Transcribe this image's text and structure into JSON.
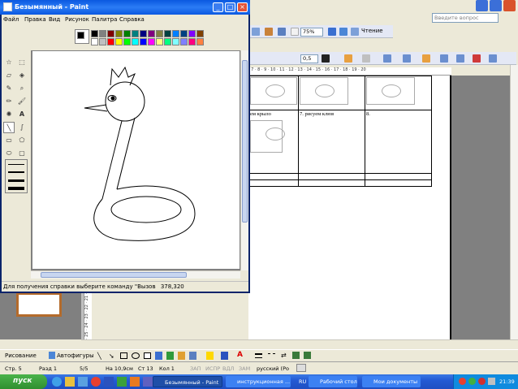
{
  "word": {
    "ask_placeholder": "Введите вопрос",
    "zoom": "75%",
    "read_button": "Чтение",
    "font_size": "0,5",
    "ruler": "· 7 · 8 · 9 · 10 · 11 · 12 · 13 · 14 · 15 · 16 · 17 · 18 · 19 · 20",
    "vruler": "· 25 · 24 · 23 · 22 · 21 ·",
    "table": {
      "cell_a": "ем крыло",
      "cell_b": "7. рисуем клюв",
      "cell_c": "8."
    },
    "draw_toolbar": {
      "drawing": "Рисование",
      "autoshapes": "Автофигуры"
    },
    "status": {
      "page": "Стр. 5",
      "section": "Разд 1",
      "pages": "5/5",
      "position": "На 10,9см",
      "line": "Ст 13",
      "col": "Кол 1",
      "rec": "ЗАП",
      "trk": "ИСПР",
      "ext": "ВДЛ",
      "ovr": "ЗАМ",
      "lang": "русский (Ро"
    }
  },
  "paint": {
    "title": "Безымянный - Paint",
    "menu": [
      "Файл",
      "Правка",
      "Вид",
      "Рисунок",
      "Палитра",
      "Справка"
    ],
    "palette": [
      "#000000",
      "#808080",
      "#800000",
      "#808000",
      "#008000",
      "#008080",
      "#000080",
      "#800080",
      "#808040",
      "#004040",
      "#0080ff",
      "#004080",
      "#8000ff",
      "#804000",
      "#ffffff",
      "#c0c0c0",
      "#ff0000",
      "#ffff00",
      "#00ff00",
      "#00ffff",
      "#0000ff",
      "#ff00ff",
      "#ffff80",
      "#00ff80",
      "#80ffff",
      "#8080ff",
      "#ff0080",
      "#ff8040"
    ],
    "status": "Для получения справки выберите команду \"Вызов",
    "coords": "378,320"
  },
  "taskbar": {
    "start": "пуск",
    "tasks": [
      "Безымянный - Paint",
      "инструкционная ...",
      "Рабочий стол",
      "Мои документы"
    ],
    "lang": "RU",
    "clock": "21:39"
  }
}
